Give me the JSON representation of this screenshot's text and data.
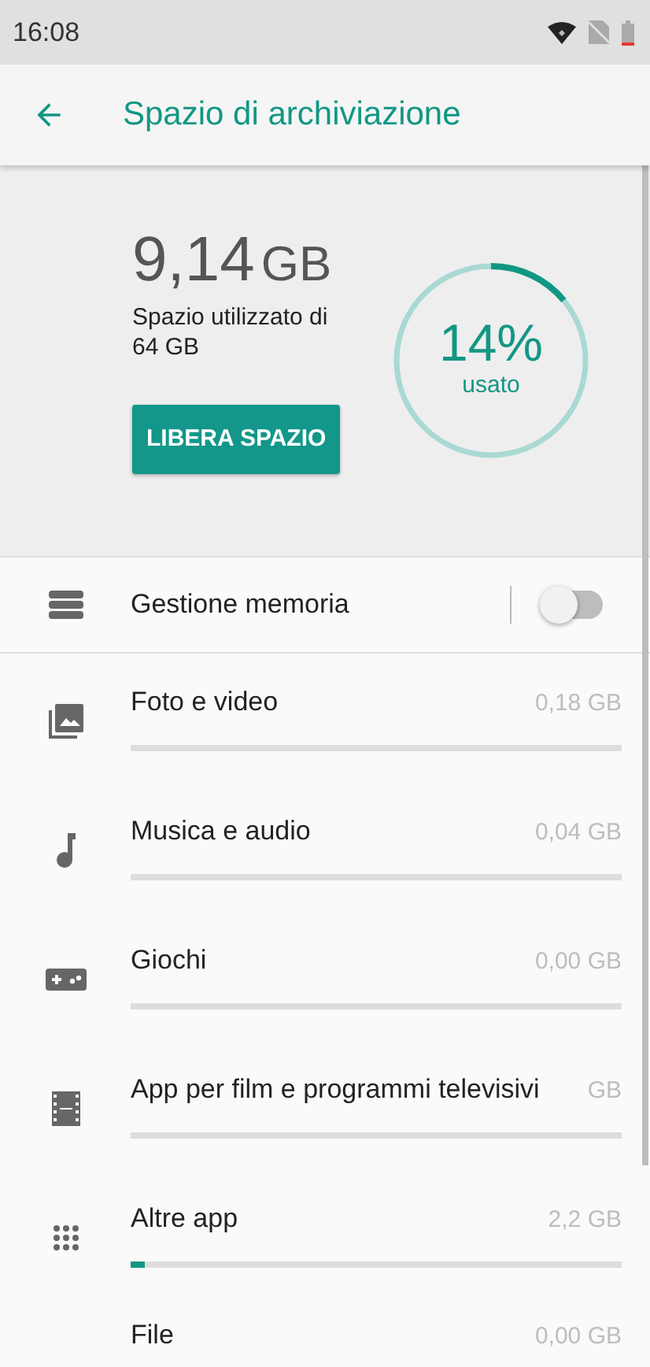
{
  "status_bar": {
    "time": "16:08"
  },
  "app_bar": {
    "title": "Spazio di archiviazione"
  },
  "summary": {
    "used": "9,14",
    "unit": "GB",
    "caption": "Spazio utilizzato di 64 GB",
    "button": "LIBERA SPAZIO",
    "percent": "14%",
    "percent_label": "usato"
  },
  "storage_manager": {
    "label": "Gestione memoria",
    "on": false
  },
  "categories": [
    {
      "label": "Foto e video",
      "size": "0,18 GB"
    },
    {
      "label": "Musica e audio",
      "size": "0,04 GB"
    },
    {
      "label": "Giochi",
      "size": "0,00 GB"
    },
    {
      "label": "App per film e programmi televisivi",
      "size": "GB"
    },
    {
      "label": "Altre app",
      "size": "2,2 GB",
      "level": 0.03
    },
    {
      "label": "File",
      "size": "0,00 GB"
    }
  ]
}
